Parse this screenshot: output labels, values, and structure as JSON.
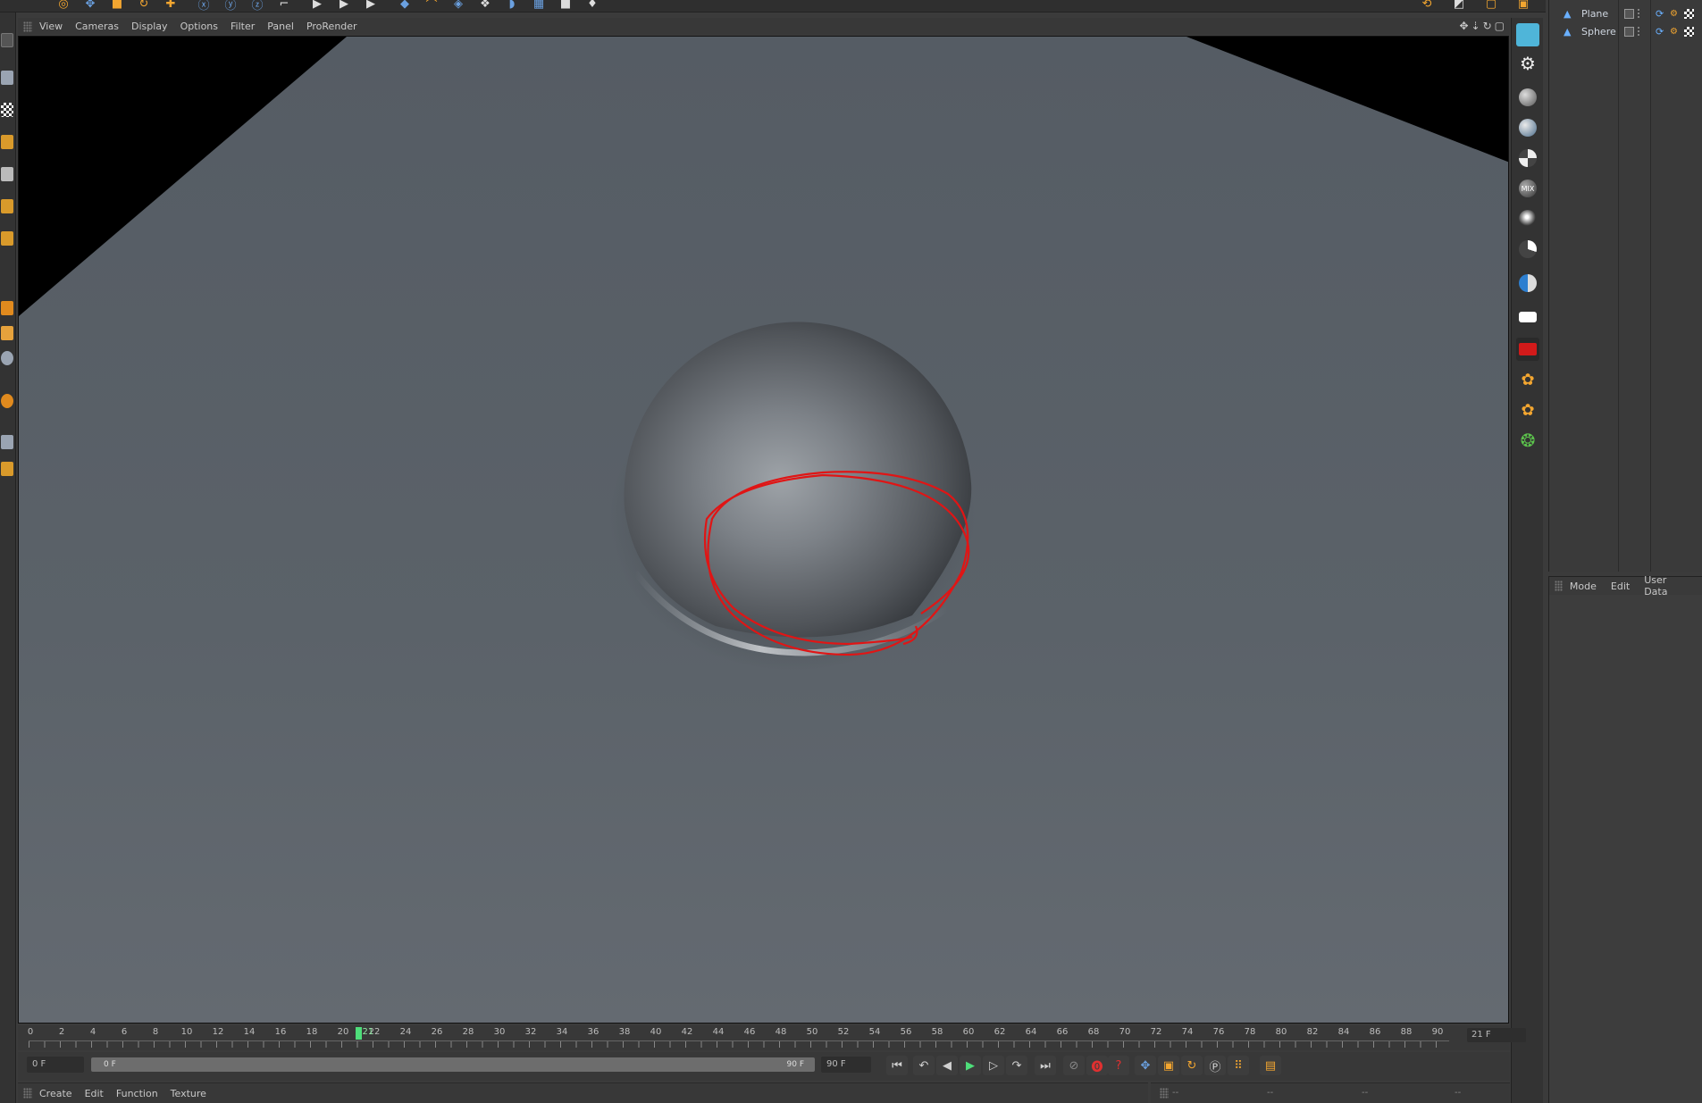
{
  "viewport_menu": {
    "items": [
      "View",
      "Cameras",
      "Display",
      "Options",
      "Filter",
      "Panel",
      "ProRender"
    ]
  },
  "object_manager": {
    "objects": [
      {
        "name": "Plane",
        "icon": "plane-object-icon"
      },
      {
        "name": "Sphere",
        "icon": "sphere-object-icon"
      }
    ]
  },
  "attributes": {
    "menu": [
      "Mode",
      "Edit",
      "User Data"
    ]
  },
  "timeline": {
    "ticks": [
      "0",
      "2",
      "4",
      "6",
      "8",
      "10",
      "12",
      "14",
      "16",
      "18",
      "20",
      "22",
      "24",
      "26",
      "28",
      "30",
      "32",
      "34",
      "36",
      "38",
      "40",
      "42",
      "44",
      "46",
      "48",
      "50",
      "52",
      "54",
      "56",
      "58",
      "60",
      "62",
      "64",
      "66",
      "68",
      "70",
      "72",
      "74",
      "76",
      "78",
      "80",
      "82",
      "84",
      "86",
      "88",
      "90"
    ],
    "current_frame": 21,
    "current_frame_label": "21",
    "end_field": "21 F"
  },
  "transport": {
    "start_field": "0 F",
    "range_start": "0 F",
    "range_end": "90 F",
    "end_field": "90 F"
  },
  "material_menu": {
    "items": [
      "Create",
      "Edit",
      "Function",
      "Texture"
    ]
  },
  "coordinates": {
    "placeholders": [
      "--",
      "--",
      "--",
      "--"
    ]
  },
  "colors": {
    "accent_orange": "#f3a630",
    "annotation_red": "#e01515",
    "frame_marker": "#4ede7a",
    "plane": "#5a6169",
    "background_black": "#000000"
  }
}
